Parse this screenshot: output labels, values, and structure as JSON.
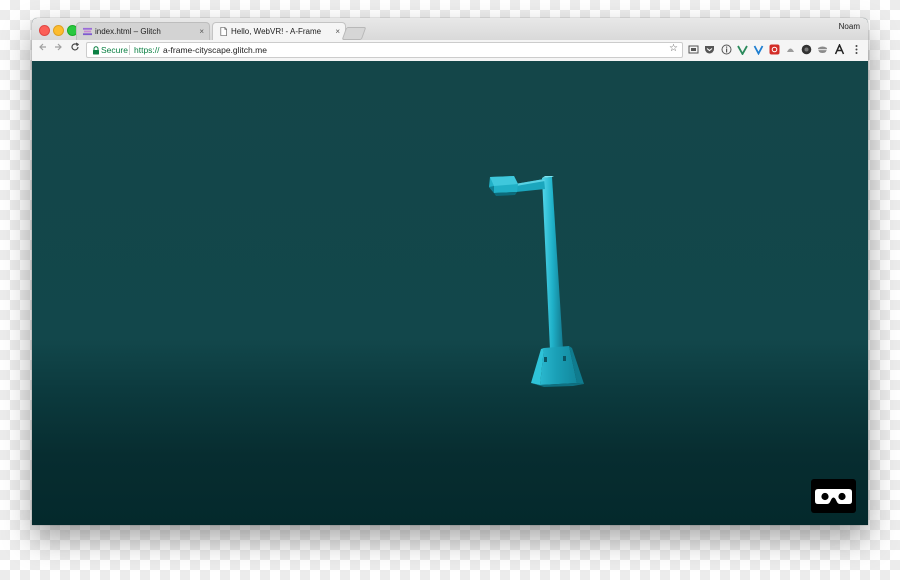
{
  "browser": {
    "profile_name": "Noam",
    "tabs": [
      {
        "title": "index.html – Glitch",
        "close": "×",
        "active": false,
        "icon": "glitch-fish-icon"
      },
      {
        "title": "Hello, WebVR! - A-Frame",
        "close": "×",
        "active": true,
        "icon": "page-icon"
      }
    ],
    "omnibox": {
      "secure_label": "Secure",
      "url_scheme": "https://",
      "url_host": "a-frame-cityscape.glitch.me"
    },
    "extension_icons": [
      "cast-icon",
      "pocket-icon",
      "info-icon",
      "vue-devtools-icon",
      "v-extension-icon",
      "lastpass-icon",
      "honey-icon",
      "dark-reader-icon",
      "mask-icon",
      "font-a-icon",
      "more-menu-icon"
    ],
    "colors": {
      "secure_green": "#0b8043",
      "scene_background": "#12454a",
      "lamp_color": "#1fb1c9"
    }
  },
  "scene": {
    "objects": [
      "street-lamp"
    ],
    "vr_button_icon": "vr-goggles-icon"
  }
}
